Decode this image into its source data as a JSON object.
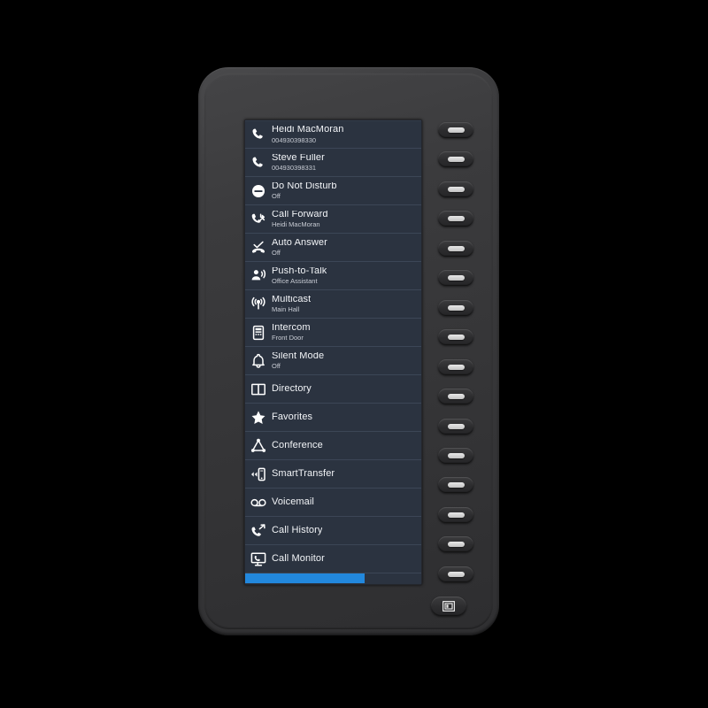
{
  "device": {
    "name": "expansion-module",
    "accent_color": "#2288dd",
    "screen_bg": "#2b3340",
    "body_color": "#3a3a3c"
  },
  "screen": {
    "rows": [
      {
        "icon": "phone-handset-icon",
        "title": "Heidi MacMoran",
        "subtitle": "004930398330"
      },
      {
        "icon": "phone-handset-icon",
        "title": "Steve Fuller",
        "subtitle": "004930398331"
      },
      {
        "icon": "do-not-disturb-icon",
        "title": "Do Not Disturb",
        "subtitle": "Off"
      },
      {
        "icon": "call-forward-icon",
        "title": "Call Forward",
        "subtitle": "Heidi MacMoran"
      },
      {
        "icon": "auto-answer-icon",
        "title": "Auto Answer",
        "subtitle": "Off"
      },
      {
        "icon": "push-to-talk-icon",
        "title": "Push-to-Talk",
        "subtitle": "Office Assistant"
      },
      {
        "icon": "multicast-antenna-icon",
        "title": "Multicast",
        "subtitle": "Main Hall"
      },
      {
        "icon": "intercom-panel-icon",
        "title": "Intercom",
        "subtitle": "Front Door"
      },
      {
        "icon": "bell-icon",
        "title": "Silent Mode",
        "subtitle": "Off"
      },
      {
        "icon": "book-icon",
        "title": "Directory",
        "subtitle": ""
      },
      {
        "icon": "star-icon",
        "title": "Favorites",
        "subtitle": ""
      },
      {
        "icon": "conference-icon",
        "title": "Conference",
        "subtitle": ""
      },
      {
        "icon": "smart-transfer-icon",
        "title": "SmartTransfer",
        "subtitle": ""
      },
      {
        "icon": "voicemail-icon",
        "title": "Voicemail",
        "subtitle": ""
      },
      {
        "icon": "call-history-icon",
        "title": "Call History",
        "subtitle": ""
      },
      {
        "icon": "call-monitor-icon",
        "title": "Call Monitor",
        "subtitle": ""
      }
    ],
    "page_indicator": {
      "fill_percent": 68,
      "color": "#2288dd"
    }
  },
  "side_keys": {
    "count": 16,
    "label": "line-key"
  },
  "page_switch_key": {
    "icon": "page-switch-icon",
    "label": "Page"
  }
}
